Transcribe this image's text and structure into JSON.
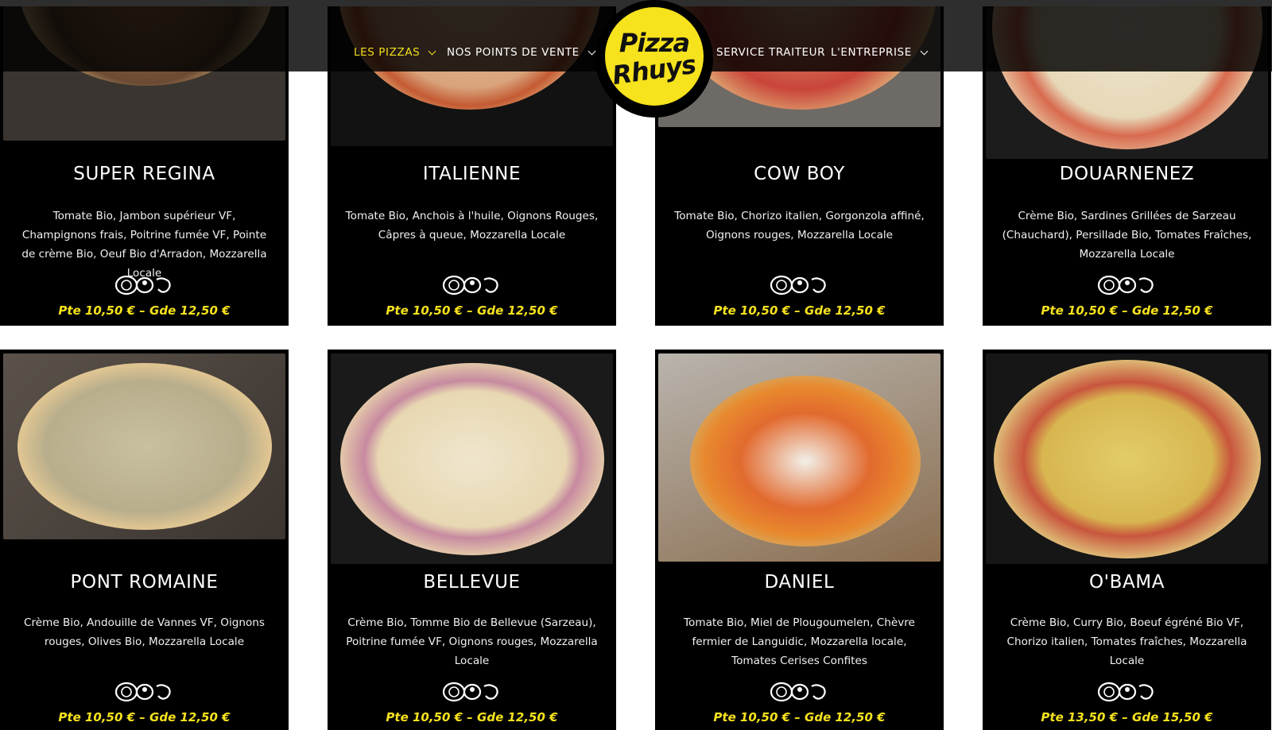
{
  "nav": {
    "items": [
      {
        "label": "LES PIZZAS"
      },
      {
        "label": "NOS POINTS DE VENTE"
      },
      {
        "label": "SERVICE TRAITEUR"
      },
      {
        "label": "L'ENTREPRISE"
      }
    ],
    "logo": {
      "line1": "Pizza",
      "line2": "Rhuys"
    }
  },
  "colors": {
    "accent": "#f6e21d",
    "card_bg": "#000000"
  },
  "pizzas": [
    {
      "name": "SUPER REGINA",
      "desc": "Tomate Bio, Jambon supérieur VF, Champignons frais, Poitrine fumée VF, Pointe de crème Bio, Oeuf Bio d'Arradon, Mozzarella Locale",
      "price": "Pte 10,50 € – Gde 12,50 €"
    },
    {
      "name": "ITALIENNE",
      "desc": "Tomate Bio, Anchois à l'huile, Oignons Rouges, Câpres à queue, Mozzarella Locale",
      "price": "Pte 10,50 € – Gde 12,50 €"
    },
    {
      "name": "COW BOY",
      "desc": "Tomate Bio, Chorizo italien, Gorgonzola affiné, Oignons rouges, Mozzarella Locale",
      "price": "Pte 10,50 € – Gde 12,50 €"
    },
    {
      "name": "DOUARNENEZ",
      "desc": "Crème Bio, Sardines Grillées de Sarzeau (Chauchard), Persillade Bio, Tomates Fraîches, Mozzarella Locale",
      "price": "Pte 10,50 € – Gde 12,50 €"
    },
    {
      "name": "PONT ROMAINE",
      "desc": "Crème Bio, Andouille de Vannes VF, Oignons rouges, Olives Bio, Mozzarella Locale",
      "price": "Pte 10,50 € – Gde 12,50 €"
    },
    {
      "name": "BELLEVUE",
      "desc": "Crème Bio, Tomme Bio de Bellevue (Sarzeau), Poitrine fumée VF, Oignons rouges, Mozzarella Locale",
      "price": "Pte 10,50 € – Gde 12,50 €"
    },
    {
      "name": "DANIEL",
      "desc": "Tomate Bio, Miel de Plougoumelen, Chèvre fermier de Languidic, Mozzarella locale, Tomates Cerises Confites",
      "price": "Pte 10,50 € – Gde 12,50 €"
    },
    {
      "name": "O'BAMA",
      "desc": "Crème Bio, Curry Bio, Boeuf égréné Bio VF, Chorizo italien, Tomates fraîches, Mozzarella Locale",
      "price": "Pte 13,50 € – Gde 15,50 €"
    }
  ]
}
